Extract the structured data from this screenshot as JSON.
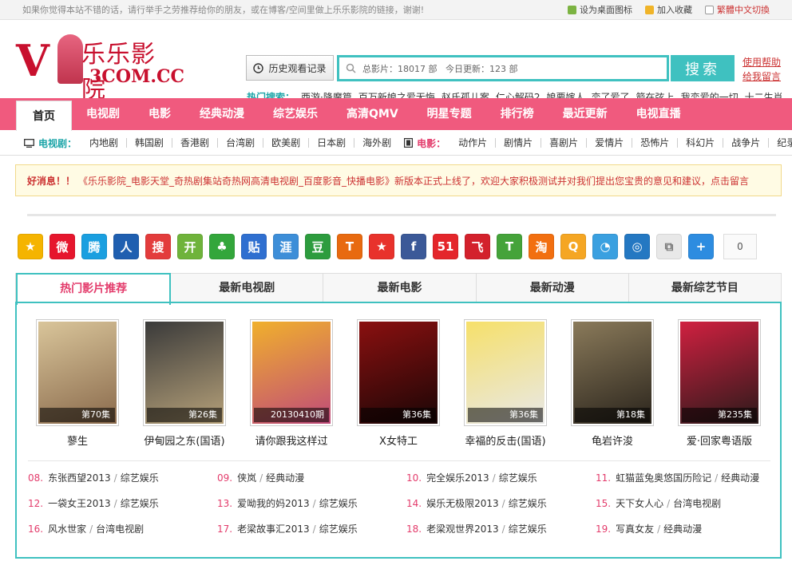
{
  "topbar": {
    "message": "如果你觉得本站不错的话，请行举手之劳推荐给你的朋友，或在博客/空间里做上乐乐影院的链接，谢谢!",
    "set_desktop": "设为桌面图标",
    "add_fav": "加入收藏",
    "switch_lang": "繁體中文切換"
  },
  "logo": {
    "v": "V",
    "name": "乐乐影院",
    "domain": "3COM.CC"
  },
  "history_button": "历史观看记录",
  "search": {
    "value": "总影片：18017 部   今日更新：123 部",
    "button": "搜索"
  },
  "help": {
    "usage": "使用帮助",
    "feedback": "给我留言"
  },
  "hot_search": {
    "label": "热门搜索：",
    "items": [
      "西游·降魔篇",
      "百万新娘之爱无悔",
      "赵氏孤儿案",
      "仁心解码2",
      "娘要嫁人",
      "恋了爱了",
      "箭在弦上",
      "我恋爱的一切",
      "十二生肖"
    ]
  },
  "nav": [
    "首页",
    "电视剧",
    "电影",
    "经典动漫",
    "综艺娱乐",
    "高清QMV",
    "明星专题",
    "排行榜",
    "最近更新",
    "电视直播"
  ],
  "subnav": {
    "tv_label": "电视剧：",
    "tv": [
      "内地剧",
      "韩国剧",
      "香港剧",
      "台湾剧",
      "欧美剧",
      "日本剧",
      "海外剧"
    ],
    "movie_label": "电影：",
    "movie": [
      "动作片",
      "剧情片",
      "喜剧片",
      "爱情片",
      "恐怖片",
      "科幻片",
      "战争片",
      "纪录片"
    ]
  },
  "notice": {
    "prefix": "好消息！！",
    "text": "《乐乐影院_电影天堂_奇热剧集站奇热网高清电视剧_百度影音_快播电影》新版本正式上线了，欢迎大家积极测试并对我们提出您宝贵的意见和建议，点击留言"
  },
  "share": {
    "icons": [
      {
        "name": "qzone-icon",
        "label": "★",
        "color": "#f5b400"
      },
      {
        "name": "weibo-icon",
        "label": "微",
        "color": "#e6162d"
      },
      {
        "name": "tencent-weibo-icon",
        "label": "腾",
        "color": "#1a9fe0"
      },
      {
        "name": "renren-icon",
        "label": "人",
        "color": "#1f5fb0"
      },
      {
        "name": "sohu-icon",
        "label": "搜",
        "color": "#e33c3c"
      },
      {
        "name": "kaixin-icon",
        "label": "开",
        "color": "#6fb33b"
      },
      {
        "name": "clover-icon",
        "label": "♣",
        "color": "#33a63b"
      },
      {
        "name": "tieba-icon",
        "label": "贴",
        "color": "#2f6fd0"
      },
      {
        "name": "netease-icon",
        "label": "涯",
        "color": "#3d8ed8"
      },
      {
        "name": "douban-icon",
        "label": "豆",
        "color": "#2d9c3e"
      },
      {
        "name": "tianya-icon",
        "label": "T",
        "color": "#e86a10"
      },
      {
        "name": "star-icon",
        "label": "★",
        "color": "#e8322c"
      },
      {
        "name": "facebook-icon",
        "label": "f",
        "color": "#3b5998"
      },
      {
        "name": "51-icon",
        "label": "51",
        "color": "#e4262b"
      },
      {
        "name": "feixin-icon",
        "label": "飞",
        "color": "#d3212c"
      },
      {
        "name": "tongtong-icon",
        "label": "T",
        "color": "#45a33a"
      },
      {
        "name": "taobao-icon",
        "label": "淘",
        "color": "#f26f10"
      },
      {
        "name": "q-icon",
        "label": "Q",
        "color": "#f5a623"
      },
      {
        "name": "pengyou-icon",
        "label": "◔",
        "color": "#3aa0e0"
      },
      {
        "name": "qq-icon",
        "label": "◎",
        "color": "#2478c2"
      },
      {
        "name": "copy-icon",
        "label": "⧉",
        "color": "#e8e8e8"
      },
      {
        "name": "more-icon",
        "label": "+",
        "color": "#2d8ce0"
      }
    ],
    "count": "0"
  },
  "tabs": [
    "热门影片推荐",
    "最新电视剧",
    "最新电影",
    "最新动漫",
    "最新综艺节目"
  ],
  "movies": [
    {
      "title": "蓼生",
      "ep": "第70集",
      "c1": "#d9c59a",
      "c2": "#8a6a4c"
    },
    {
      "title": "伊甸园之东(国语)",
      "ep": "第26集",
      "c1": "#3a3a3a",
      "c2": "#b7a27a"
    },
    {
      "title": "请你跟我这样过",
      "ep": "20130410期",
      "c1": "#f0b02c",
      "c2": "#c04a7a"
    },
    {
      "title": "X女特工",
      "ep": "第36集",
      "c1": "#8a1010",
      "c2": "#1a0606"
    },
    {
      "title": "幸福的反击(国语)",
      "ep": "第36集",
      "c1": "#f6e06a",
      "c2": "#e8e8e8"
    },
    {
      "title": "龟岩许浚",
      "ep": "第18集",
      "c1": "#8a7a5a",
      "c2": "#2a241c"
    },
    {
      "title": "爱·回家粤语版",
      "ep": "第235集",
      "c1": "#d02040",
      "c2": "#2a1a1a"
    }
  ],
  "list": [
    {
      "n": "08.",
      "title": "东张西望2013",
      "cat": "综艺娱乐"
    },
    {
      "n": "09.",
      "title": "侠岚",
      "cat": "经典动漫"
    },
    {
      "n": "10.",
      "title": "完全娱乐2013",
      "cat": "综艺娱乐"
    },
    {
      "n": "11.",
      "title": "虹猫蓝兔奥悠国历险记",
      "cat": "经典动漫"
    },
    {
      "n": "12.",
      "title": "一袋女王2013",
      "cat": "综艺娱乐"
    },
    {
      "n": "13.",
      "title": "爱呦我的妈2013",
      "cat": "综艺娱乐"
    },
    {
      "n": "14.",
      "title": "娱乐无极限2013",
      "cat": "综艺娱乐"
    },
    {
      "n": "15.",
      "title": "天下女人心",
      "cat": "台湾电视剧"
    },
    {
      "n": "16.",
      "title": "风水世家",
      "cat": "台湾电视剧"
    },
    {
      "n": "17.",
      "title": "老梁故事汇2013",
      "cat": "综艺娱乐"
    },
    {
      "n": "18.",
      "title": "老梁观世界2013",
      "cat": "综艺娱乐"
    },
    {
      "n": "19.",
      "title": "写真女友",
      "cat": "经典动漫"
    }
  ]
}
